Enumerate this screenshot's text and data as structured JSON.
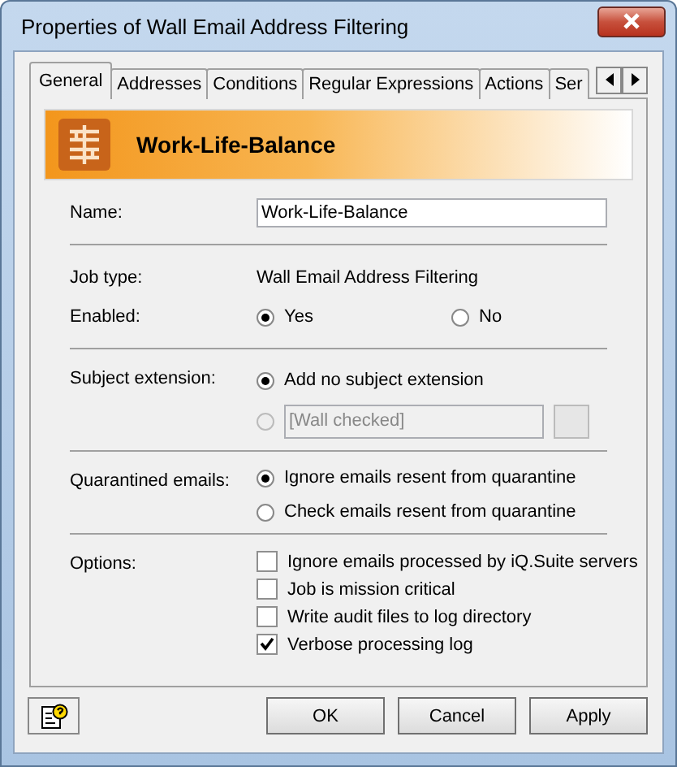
{
  "window": {
    "title": "Properties of Wall Email Address Filtering"
  },
  "tabs": [
    {
      "label": "General",
      "selected": true
    },
    {
      "label": "Addresses",
      "selected": false
    },
    {
      "label": "Conditions",
      "selected": false
    },
    {
      "label": "Regular Expressions",
      "selected": false
    },
    {
      "label": "Actions",
      "selected": false
    },
    {
      "label": "Ser",
      "selected": false
    }
  ],
  "header": {
    "title": "Work-Life-Balance"
  },
  "name": {
    "label": "Name:",
    "value": "Work-Life-Balance"
  },
  "job_type": {
    "label": "Job type:",
    "value": "Wall Email Address Filtering"
  },
  "enabled": {
    "label": "Enabled:",
    "options": [
      {
        "label": "Yes",
        "selected": true
      },
      {
        "label": "No",
        "selected": false
      }
    ]
  },
  "subject_extension": {
    "label": "Subject extension:",
    "options": [
      {
        "kind": "text",
        "label": "Add no subject extension",
        "selected": true,
        "disabled": false
      },
      {
        "kind": "field",
        "value": "[Wall checked]",
        "selected": false,
        "disabled": true
      }
    ]
  },
  "quarantined": {
    "label": "Quarantined emails:",
    "options": [
      {
        "label": "Ignore emails resent from quarantine",
        "selected": true
      },
      {
        "label": "Check emails resent from quarantine",
        "selected": false
      }
    ]
  },
  "options": {
    "label": "Options:",
    "items": [
      {
        "label": "Ignore emails processed by iQ.Suite servers",
        "checked": false
      },
      {
        "label": "Job is mission critical",
        "checked": false
      },
      {
        "label": "Write audit files to log directory",
        "checked": false
      },
      {
        "label": "Verbose processing log",
        "checked": true
      }
    ]
  },
  "buttons": [
    {
      "label": "OK"
    },
    {
      "label": "Cancel"
    },
    {
      "label": "Apply"
    }
  ]
}
